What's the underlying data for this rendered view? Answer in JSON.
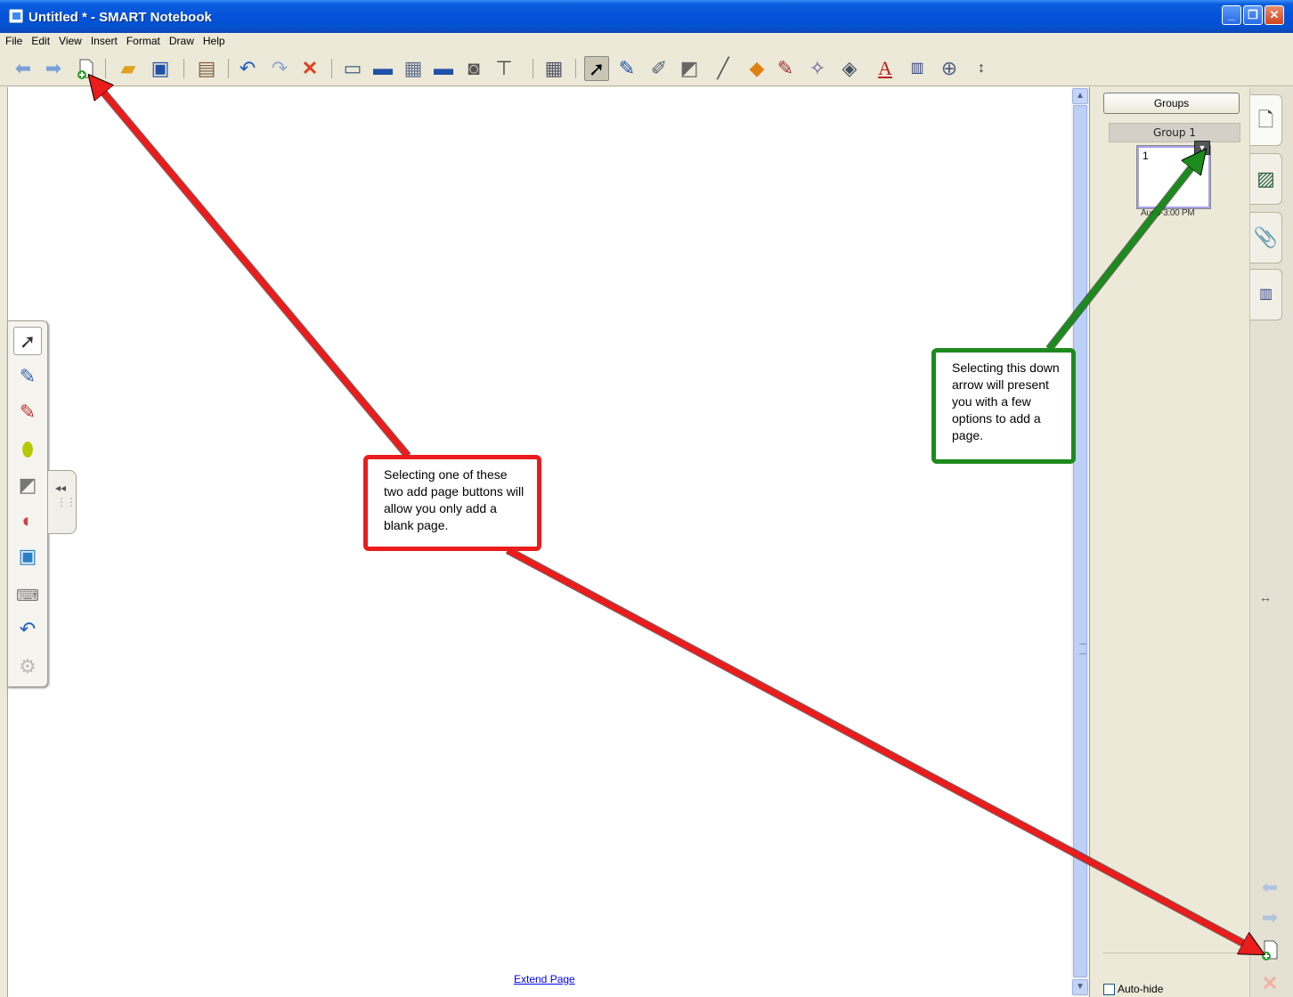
{
  "window": {
    "title": "Untitled * - SMART Notebook",
    "min_glyph": "_",
    "max_glyph": "❐",
    "close_glyph": "✕"
  },
  "menu": [
    "File",
    "Edit",
    "View",
    "Insert",
    "Format",
    "Draw",
    "Help"
  ],
  "toolbar": {
    "icons": [
      "back-arrow-icon",
      "forward-arrow-icon",
      "add-page-icon",
      "open-folder-icon",
      "save-icon",
      "paste-icon",
      "undo-icon",
      "redo-icon",
      "delete-icon",
      "show-hide-screen-icon",
      "full-screen-icon",
      "transparent-background-icon",
      "dual-page-icon",
      "screen-capture-icon",
      "document-camera-icon",
      "table-icon",
      "select-icon",
      "pen-icon",
      "creative-pen-icon",
      "eraser-icon",
      "line-icon",
      "shape-icon",
      "fill-icon",
      "magic-pen-icon",
      "fill-color-icon",
      "text-icon",
      "properties-icon",
      "measurement-icon",
      "move-toolbar-icon"
    ]
  },
  "canvas": {
    "extend_page_label": "Extend Page"
  },
  "float_tools": [
    "select-icon",
    "pen-icon",
    "pen-icon",
    "highlighter-icon",
    "eraser-icon",
    "magic-eraser-icon",
    "notebook-icon",
    "keyboard-icon",
    "undo-icon",
    "settings-icon"
  ],
  "sidepanel": {
    "groups_label": "Groups",
    "group_name": "Group 1",
    "page_number": "1",
    "page_time": "Aug6-3:00 PM",
    "autohide_label": "Auto-hide"
  },
  "tabs": [
    "page-sorter-tab-icon",
    "gallery-tab-icon",
    "attachments-tab-icon",
    "properties-tab-icon"
  ],
  "annotations": {
    "red_text": "Selecting one of these two add page buttons will allow you only add a blank page.",
    "green_text": "Selecting this down arrow will present you with a few options to add a page.",
    "red_color": "#ea1c1c",
    "green_color": "#1d8a1d"
  }
}
